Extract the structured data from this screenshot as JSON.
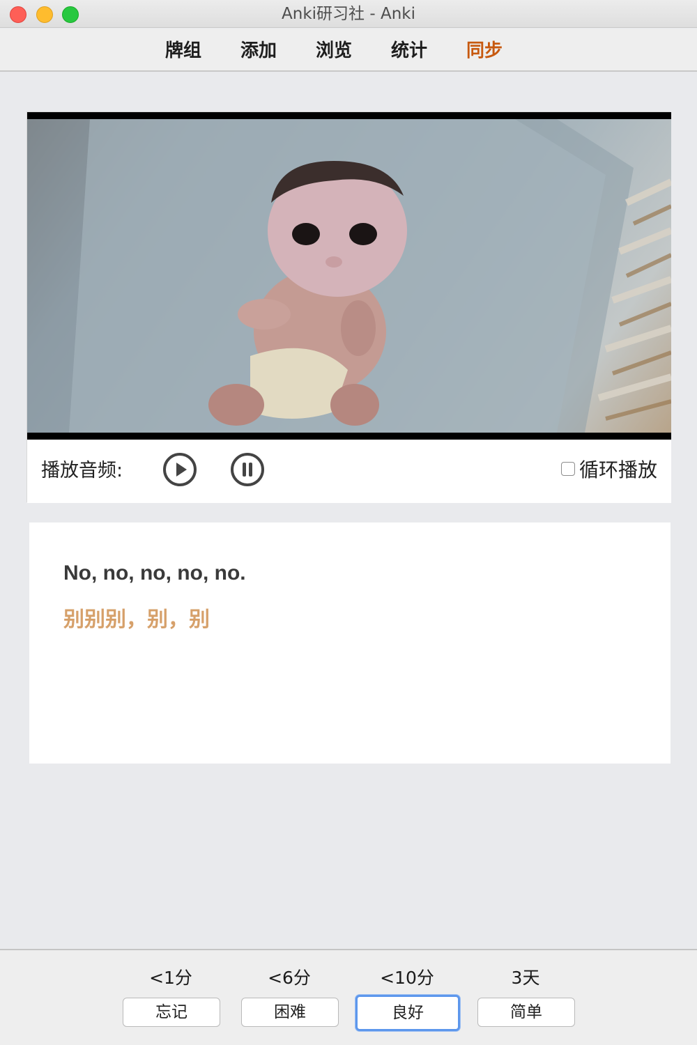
{
  "window": {
    "title": "Anki研习社 - Anki"
  },
  "toolbar": {
    "items": [
      {
        "label": "牌组",
        "active": false
      },
      {
        "label": "添加",
        "active": false
      },
      {
        "label": "浏览",
        "active": false
      },
      {
        "label": "统计",
        "active": false
      },
      {
        "label": "同步",
        "active": true
      }
    ],
    "active_color": "#c7590f"
  },
  "player": {
    "audio_label": "播放音频:",
    "play_icon": "play-circle-icon",
    "pause_icon": "pause-circle-icon",
    "loop_label": "循环播放",
    "loop_checked": false
  },
  "card": {
    "english": "No, no, no, no, no.",
    "chinese": "别别别，别，别",
    "chinese_color": "#d6a06a"
  },
  "answers": [
    {
      "interval": "<1分",
      "label": "忘记",
      "default": false
    },
    {
      "interval": "<6分",
      "label": "困难",
      "default": false
    },
    {
      "interval": "<10分",
      "label": "良好",
      "default": true
    },
    {
      "interval": "3天",
      "label": "简单",
      "default": false
    }
  ]
}
